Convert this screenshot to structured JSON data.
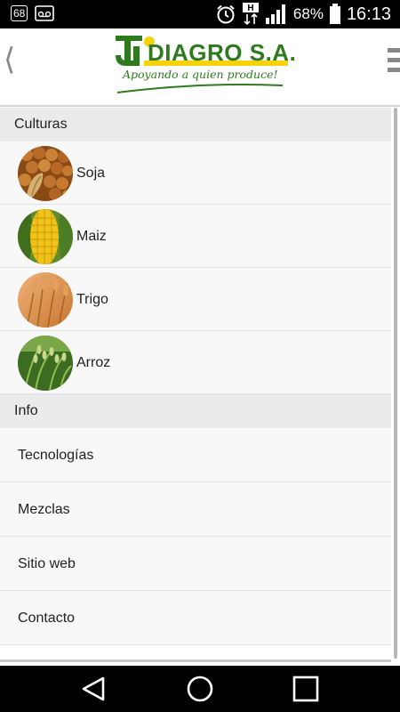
{
  "status_bar": {
    "notif_count": "68",
    "battery": "68%",
    "time": "16:13",
    "icons": [
      "notification-count-icon",
      "voicemail-icon",
      "alarm-icon",
      "hplus-data-icon",
      "signal-icon",
      "battery-icon"
    ]
  },
  "header": {
    "brand": "DIAGRO S.A.",
    "tagline": "Apoyando a quien produce!",
    "colors": {
      "brand_green": "#2f7a1f",
      "brand_yellow": "#f5d20a"
    }
  },
  "sections": {
    "culturas": {
      "title": "Culturas"
    },
    "info": {
      "title": "Info"
    }
  },
  "crops": [
    {
      "label": "Soja",
      "icon": "soy-beans-image"
    },
    {
      "label": "Maiz",
      "icon": "corn-image"
    },
    {
      "label": "Trigo",
      "icon": "wheat-image"
    },
    {
      "label": "Arroz",
      "icon": "rice-image"
    }
  ],
  "info_items": [
    {
      "label": "Tecnologías"
    },
    {
      "label": "Mezclas"
    },
    {
      "label": "Sitio web"
    },
    {
      "label": "Contacto"
    }
  ]
}
